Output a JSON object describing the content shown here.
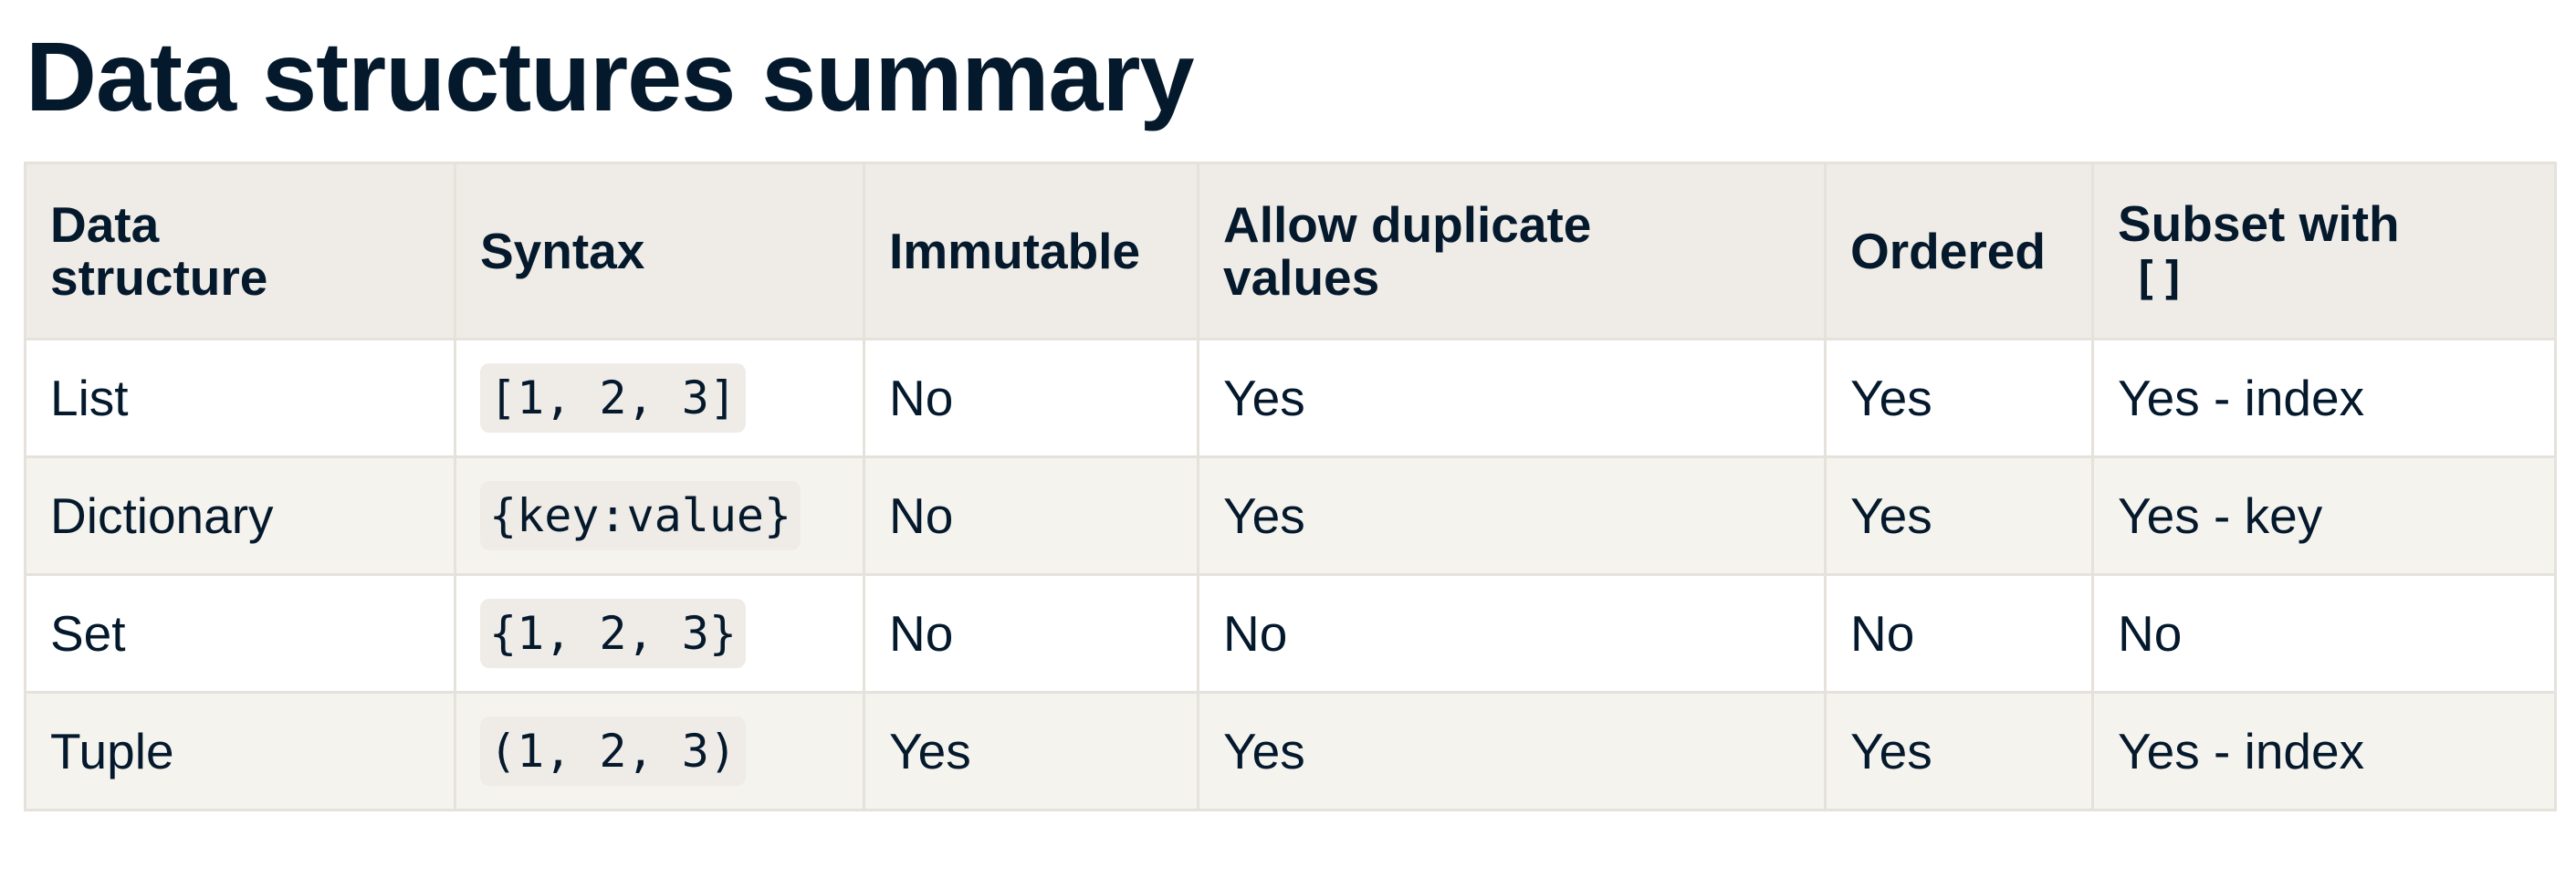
{
  "title": "Data structures summary",
  "table": {
    "headers": {
      "data_structure": [
        "Data",
        "structure"
      ],
      "syntax": "Syntax",
      "immutable": "Immutable",
      "allow_duplicates": [
        "Allow duplicate",
        "values"
      ],
      "ordered": "Ordered",
      "subset": "Subset with",
      "subset_code": "[]"
    },
    "rows": [
      {
        "structure": "List",
        "syntax": "[1, 2, 3]",
        "immutable": "No",
        "duplicates": "Yes",
        "ordered": "Yes",
        "subset": "Yes - index"
      },
      {
        "structure": "Dictionary",
        "syntax": "{key:value}",
        "immutable": "No",
        "duplicates": "Yes",
        "ordered": "Yes",
        "subset": "Yes - key"
      },
      {
        "structure": "Set",
        "syntax": "{1, 2, 3}",
        "immutable": "No",
        "duplicates": "No",
        "ordered": "No",
        "subset": "No"
      },
      {
        "structure": "Tuple",
        "syntax": "(1, 2, 3)",
        "immutable": "Yes",
        "duplicates": "Yes",
        "ordered": "Yes",
        "subset": "Yes - index"
      }
    ]
  }
}
